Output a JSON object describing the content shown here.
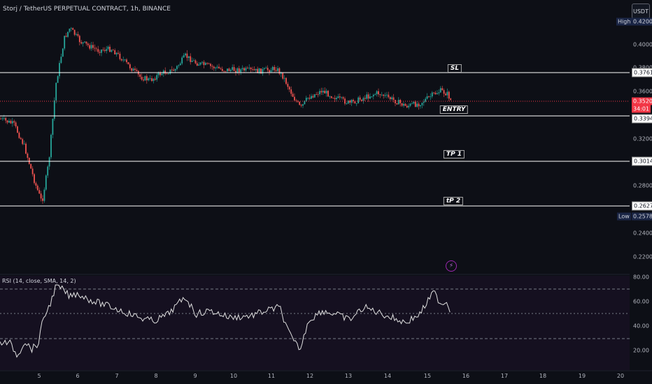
{
  "header": {
    "title": "Storj / TetherUS PERPETUAL CONTRACT, 1h, BINANCE",
    "currency_button": "USDT"
  },
  "rsi": {
    "title": "RSI (14, close, SMA, 14, 2)",
    "axis": [
      "80.00",
      "60.00",
      "40.00",
      "20.00"
    ]
  },
  "price_axis": [
    "0.4000",
    "0.3800",
    "0.3600",
    "0.3200",
    "0.2800",
    "0.2400",
    "0.2200"
  ],
  "price_tags": {
    "high_label": "High",
    "high_value": "0.4200",
    "low_label": "Low",
    "low_value": "0.2578",
    "sl_value": "0.3761",
    "current_value": "0.3520",
    "countdown": "34:01",
    "entry_value": "0.3394",
    "tp1_value": "0.3014",
    "tp2_value": "0.2627"
  },
  "levels": {
    "sl": "SL",
    "entry": "ENTRY",
    "tp1": "TP 1",
    "tp2": "tP 2"
  },
  "date_axis": [
    "5",
    "6",
    "7",
    "8",
    "9",
    "10",
    "11",
    "12",
    "13",
    "14",
    "15",
    "16",
    "17",
    "18",
    "19",
    "20"
  ],
  "icons": {
    "bolt": "lightning-bolt-icon"
  },
  "colors": {
    "up": "#26a69a",
    "down": "#ef5350",
    "background": "#0d0f16",
    "rsi_line": "#e0e0e0",
    "current_price": "#f23645"
  }
}
